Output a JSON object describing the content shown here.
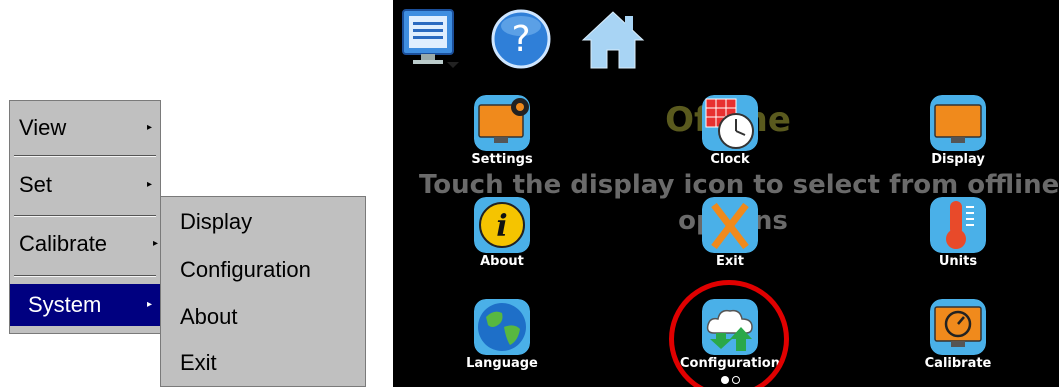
{
  "menu": {
    "items": [
      {
        "label": "View",
        "arrow": "▸"
      },
      {
        "label": "Set",
        "arrow": "▸"
      },
      {
        "label": "Calibrate",
        "arrow": "▸"
      },
      {
        "label": "System",
        "arrow": "▸"
      }
    ],
    "selected": "System"
  },
  "submenu": {
    "items": [
      {
        "label": "Display"
      },
      {
        "label": "Configuration"
      },
      {
        "label": "About"
      },
      {
        "label": "Exit"
      }
    ]
  },
  "topbar": {
    "icons": [
      "monitor-menu-icon",
      "help-icon",
      "home-icon"
    ]
  },
  "background": {
    "title": "Offline",
    "line1": "Touch the display icon to select from offline",
    "line2": "options"
  },
  "tiles": [
    {
      "label": "Settings",
      "icon": "settings-icon"
    },
    {
      "label": "Clock",
      "icon": "clock-icon"
    },
    {
      "label": "Display",
      "icon": "display-icon"
    },
    {
      "label": "About",
      "icon": "about-icon"
    },
    {
      "label": "Exit",
      "icon": "exit-icon"
    },
    {
      "label": "Units",
      "icon": "thermometer-icon"
    },
    {
      "label": "Language",
      "icon": "globe-icon"
    },
    {
      "label": "Configuration",
      "icon": "cloud-transfer-icon"
    },
    {
      "label": "Calibrate",
      "icon": "gauge-icon"
    }
  ],
  "pager": {
    "current": 1,
    "total": 2
  },
  "colors": {
    "menu_bg": "#c0c0c0",
    "menu_selected": "#000080",
    "panel_bg": "#000000",
    "highlight_ring": "#e00000",
    "tile_blue": "#4ab0e8"
  }
}
